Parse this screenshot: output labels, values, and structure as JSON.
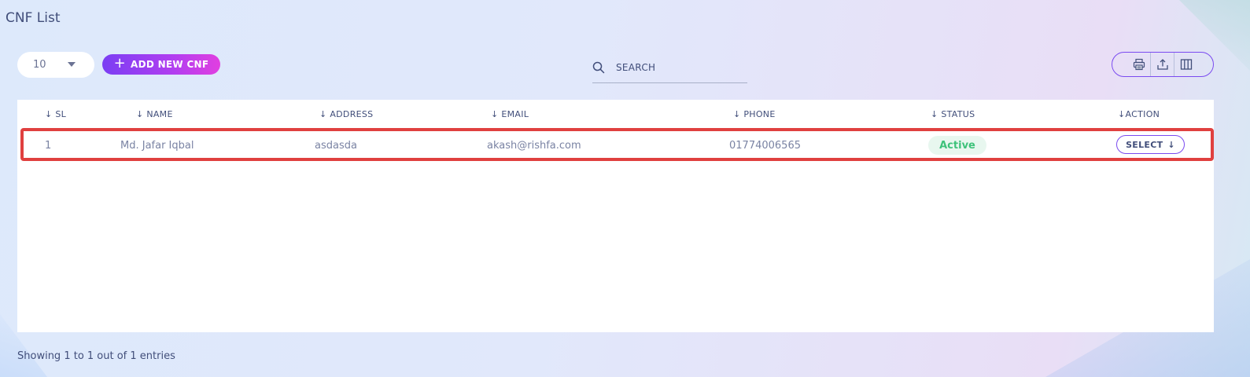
{
  "page": {
    "title": "CNF List"
  },
  "toolbar": {
    "page_size": "10",
    "add_button_label": "ADD NEW CNF",
    "search_placeholder": "SEARCH"
  },
  "table": {
    "columns": [
      "SL",
      "NAME",
      "ADDRESS",
      "EMAIL",
      "PHONE",
      "STATUS",
      "ACTION"
    ],
    "rows": [
      {
        "sl": "1",
        "name": "Md. Jafar Iqbal",
        "address": "asdasda",
        "email": "akash@rishfa.com",
        "phone": "01774006565",
        "status": "Active",
        "action_label": "SELECT"
      }
    ]
  },
  "footer": {
    "entries_text": "Showing 1 to 1 out of 1 entries"
  },
  "colors": {
    "accent": "#7a4af0",
    "highlight_border": "#e0403f",
    "status_active": "#3ec27a"
  },
  "icons": [
    "search-icon",
    "printer-icon",
    "export-icon",
    "columns-icon",
    "sort-arrow-icon",
    "chevron-down-icon"
  ]
}
